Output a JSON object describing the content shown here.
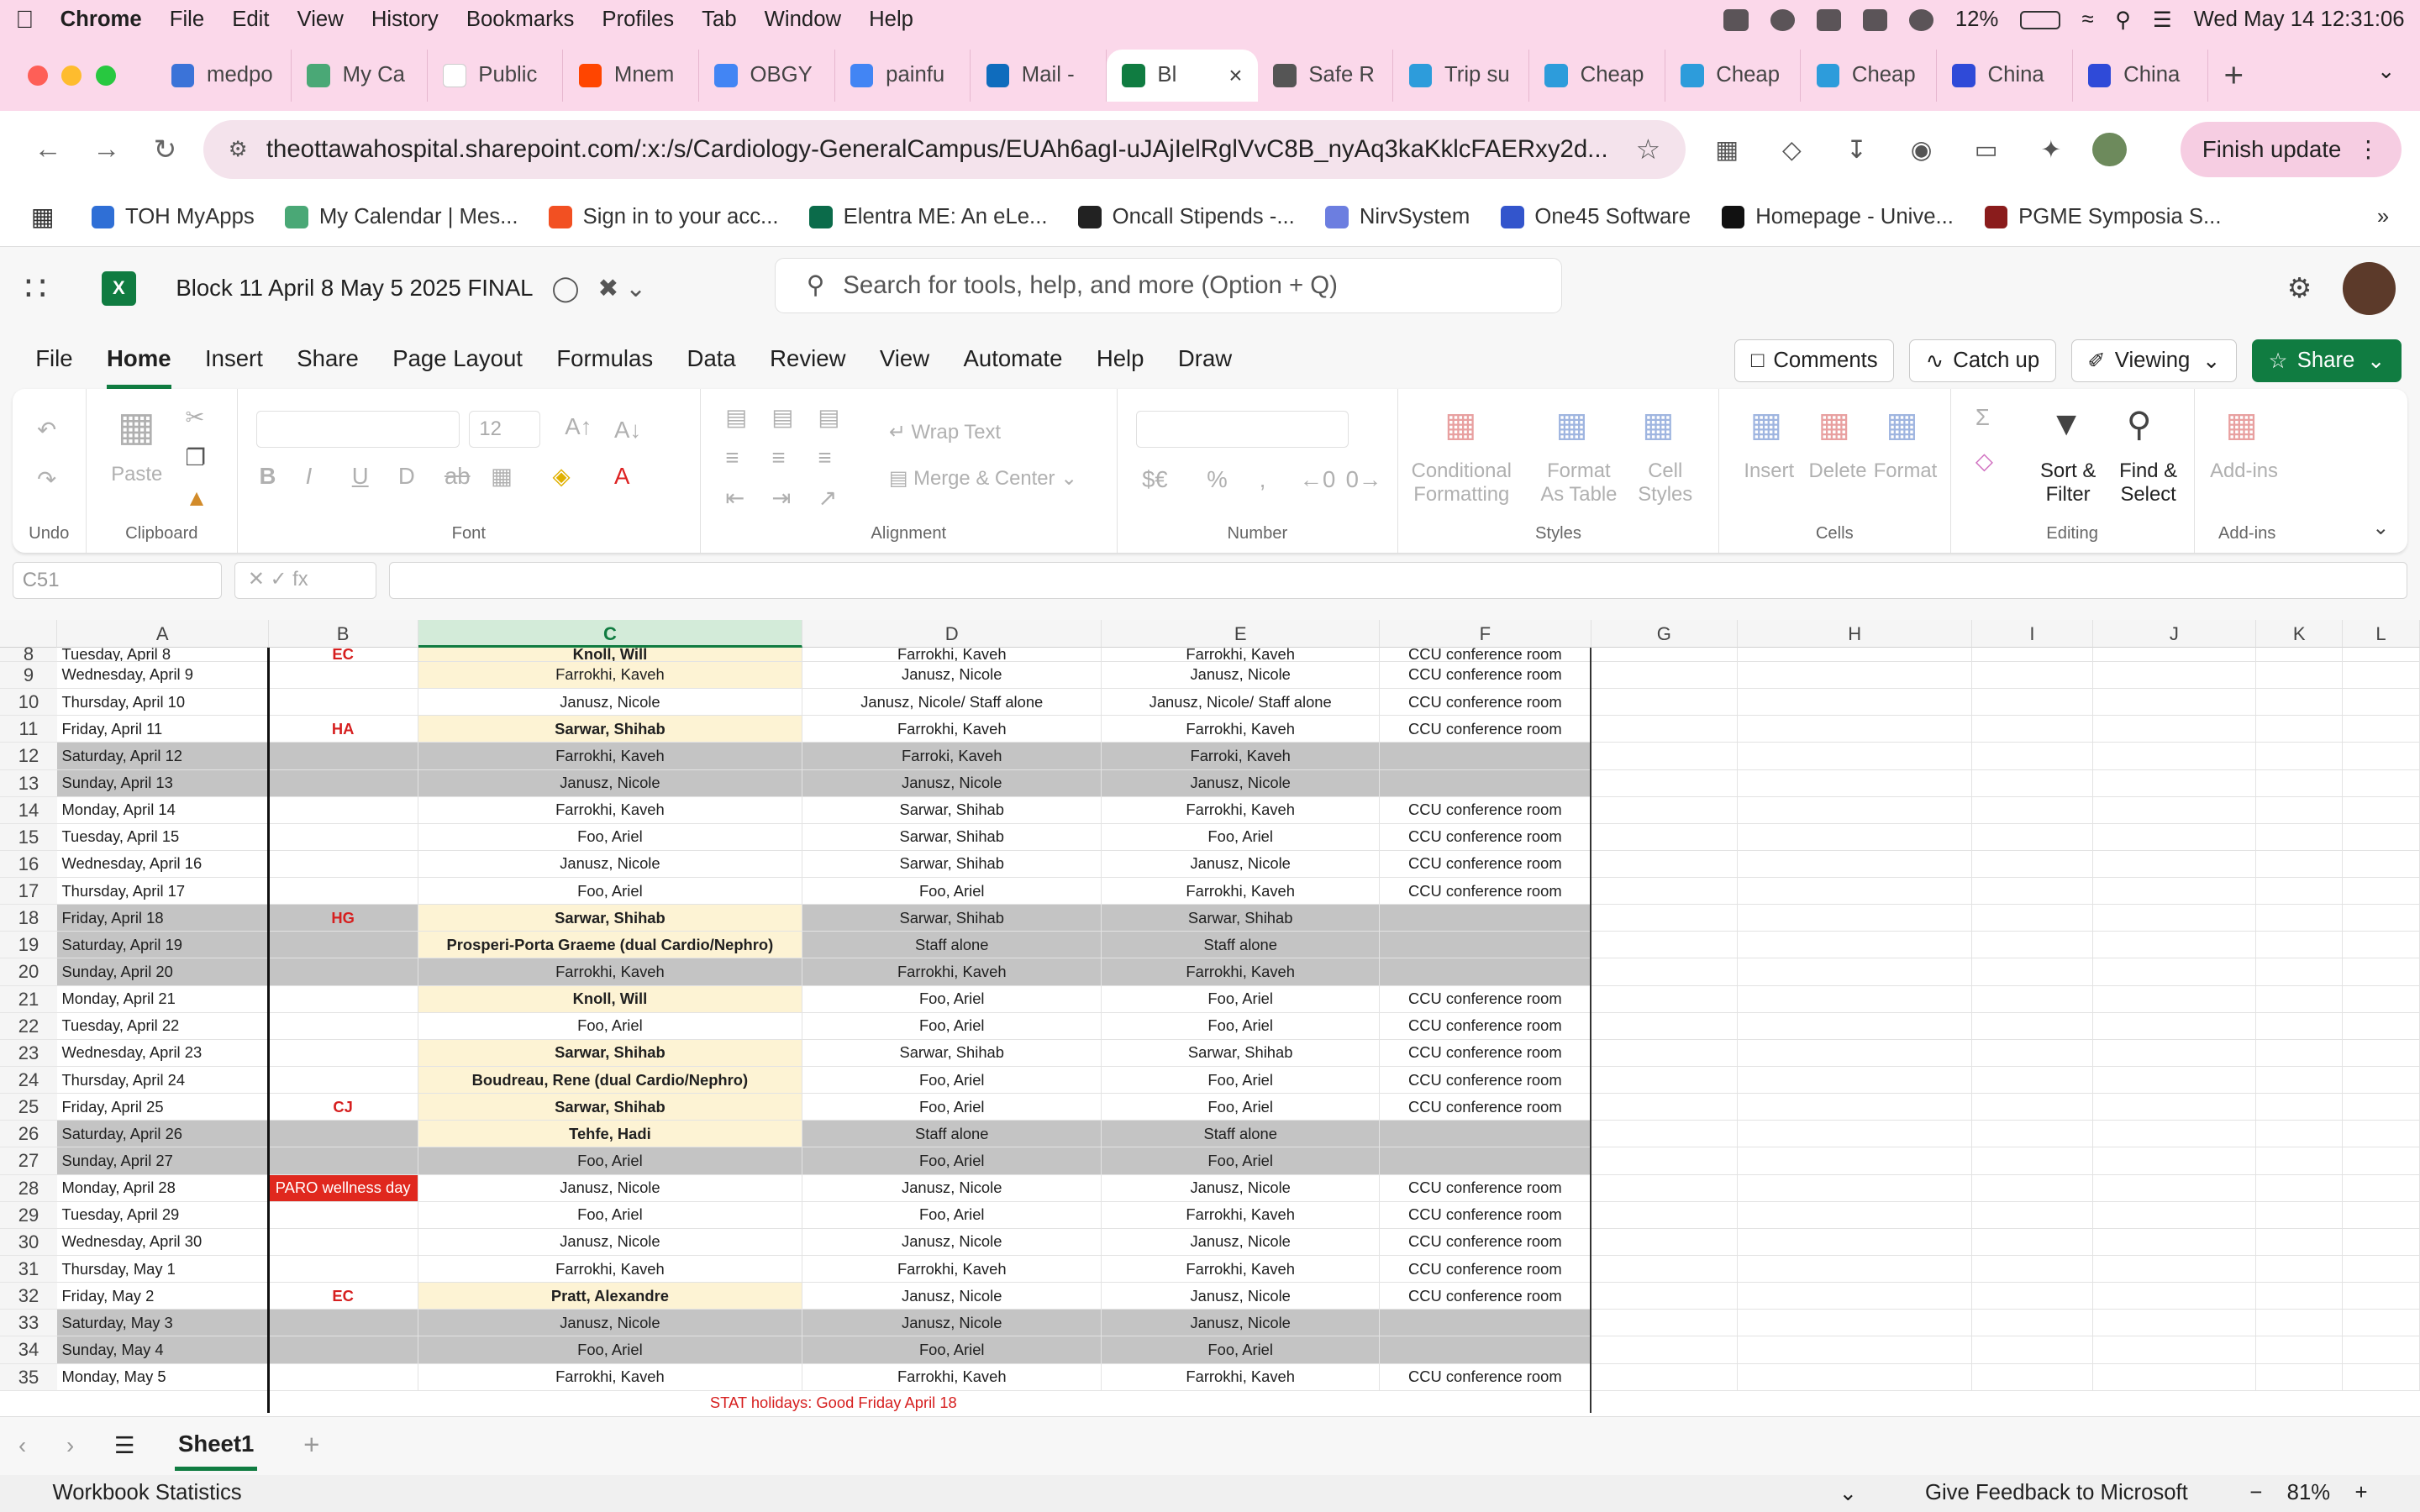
{
  "menubar": {
    "app": "Chrome",
    "items": [
      "File",
      "Edit",
      "View",
      "History",
      "Bookmarks",
      "Profiles",
      "Tab",
      "Window",
      "Help"
    ],
    "battery": "12%",
    "clock": "Wed May 14  12:31:06"
  },
  "tabs": [
    {
      "label": "medpo",
      "color": "#3b73d8"
    },
    {
      "label": "My Ca",
      "color": "#4aa876"
    },
    {
      "label": "Public",
      "color": "#ffffff"
    },
    {
      "label": "Mnem",
      "color": "#ff4500"
    },
    {
      "label": "OBGY",
      "color": "#4285f4"
    },
    {
      "label": "painfu",
      "color": "#4285f4"
    },
    {
      "label": "Mail -",
      "color": "#0f6cbd"
    },
    {
      "label": "Bl",
      "color": "#107c41"
    },
    {
      "label": "Safe R",
      "color": "#555555"
    },
    {
      "label": "Trip su",
      "color": "#2d9cdb"
    },
    {
      "label": "Cheap",
      "color": "#2d9cdb"
    },
    {
      "label": "Cheap",
      "color": "#2d9cdb"
    },
    {
      "label": "Cheap",
      "color": "#2d9cdb"
    },
    {
      "label": "China",
      "color": "#2f4ad8"
    },
    {
      "label": "China",
      "color": "#2f4ad8"
    }
  ],
  "address": {
    "url": "theottawahospital.sharepoint.com/:x:/s/Cardiology-GeneralCampus/EUAh6agI-uJAjIelRglVvC8B_nyAq3kaKklcFAERxy2d...",
    "finish": "Finish update"
  },
  "bookmarks": [
    {
      "label": "TOH MyApps",
      "color": "#2f6fd6"
    },
    {
      "label": "My Calendar | Mes...",
      "color": "#4aa876"
    },
    {
      "label": "Sign in to your acc...",
      "color": "#f25022"
    },
    {
      "label": "Elentra ME: An eLe...",
      "color": "#0b6b4a"
    },
    {
      "label": "Oncall Stipends -...",
      "color": "#222222"
    },
    {
      "label": "NirvSystem",
      "color": "#6c7ee0"
    },
    {
      "label": "One45 Software",
      "color": "#3355cc"
    },
    {
      "label": "Homepage - Unive...",
      "color": "#111111"
    },
    {
      "label": "PGME Symposia S...",
      "color": "#8a1c1c"
    }
  ],
  "excel": {
    "doc_title": "Block 11 April 8 May 5 2025 FINAL",
    "search_placeholder": "Search for tools, help, and more (Option + Q)"
  },
  "ribbon_tabs": [
    "File",
    "Home",
    "Insert",
    "Share",
    "Page Layout",
    "Formulas",
    "Data",
    "Review",
    "View",
    "Automate",
    "Help",
    "Draw"
  ],
  "ribbon_buttons": {
    "comments": "Comments",
    "catchup": "Catch up",
    "viewing": "Viewing",
    "share": "Share"
  },
  "ribbon": {
    "undo": "Undo",
    "clipboard": "Clipboard",
    "paste": "Paste",
    "font": "Font",
    "font_size": "12",
    "alignment": "Alignment",
    "wrap": "Wrap Text",
    "merge": "Merge & Center",
    "number": "Number",
    "styles": "Styles",
    "cond": "Conditional Formatting",
    "fmt_table": "Format As Table",
    "cell_styles": "Cell Styles",
    "cells": "Cells",
    "insert": "Insert",
    "delete": "Delete",
    "format": "Format",
    "editing": "Editing",
    "sort": "Sort & Filter",
    "find": "Find & Select",
    "addins": "Add-ins"
  },
  "namebox": "C51",
  "columns": [
    "A",
    "B",
    "C",
    "D",
    "E",
    "F",
    "G",
    "H",
    "I",
    "J",
    "K",
    "L"
  ],
  "rows": [
    {
      "n": "8",
      "a": "Tuesday, April 8",
      "b": "EC",
      "c": "Knoll, Will",
      "d": "Farrokhi, Kaveh",
      "e": "Farrokhi, Kaveh",
      "f": "CCU conference room",
      "w": false,
      "h": true
    },
    {
      "n": "9",
      "a": "Wednesday, April 9",
      "b": "",
      "c": "Farrokhi, Kaveh",
      "d": "Janusz, Nicole",
      "e": "Janusz, Nicole",
      "f": "CCU conference room",
      "w": false,
      "h": false,
      "hb": true
    },
    {
      "n": "10",
      "a": "Thursday, April 10",
      "b": "",
      "c": "Janusz, Nicole",
      "d": "Janusz, Nicole/ Staff alone",
      "e": "Janusz, Nicole/ Staff alone",
      "f": "CCU conference room",
      "w": false,
      "h": false
    },
    {
      "n": "11",
      "a": "Friday, April 11",
      "b": "HA",
      "c": "Sarwar, Shihab",
      "d": "Farrokhi, Kaveh",
      "e": "Farrokhi, Kaveh",
      "f": "CCU conference room",
      "w": false,
      "h": true
    },
    {
      "n": "12",
      "a": "Saturday, April 12",
      "b": "",
      "c": "Farrokhi, Kaveh",
      "d": "Farroki, Kaveh",
      "e": "Farroki, Kaveh",
      "f": "",
      "w": true,
      "h": false
    },
    {
      "n": "13",
      "a": "Sunday, April 13",
      "b": "",
      "c": "Janusz, Nicole",
      "d": "Janusz, Nicole",
      "e": "Janusz, Nicole",
      "f": "",
      "w": true,
      "h": false
    },
    {
      "n": "14",
      "a": "Monday, April 14",
      "b": "",
      "c": "Farrokhi, Kaveh",
      "d": "Sarwar, Shihab",
      "e": "Farrokhi, Kaveh",
      "f": "CCU conference room",
      "w": false,
      "h": false
    },
    {
      "n": "15",
      "a": "Tuesday, April 15",
      "b": "",
      "c": "Foo, Ariel",
      "d": "Sarwar, Shihab",
      "e": "Foo, Ariel",
      "f": "CCU conference room",
      "w": false,
      "h": false
    },
    {
      "n": "16",
      "a": "Wednesday, April 16",
      "b": "",
      "c": "Janusz, Nicole",
      "d": "Sarwar, Shihab",
      "e": "Janusz, Nicole",
      "f": "CCU conference room",
      "w": false,
      "h": false
    },
    {
      "n": "17",
      "a": "Thursday, April 17",
      "b": "",
      "c": "Foo, Ariel",
      "d": "Foo, Ariel",
      "e": "Farrokhi, Kaveh",
      "f": "CCU conference room",
      "w": false,
      "h": false
    },
    {
      "n": "18",
      "a": "Friday, April 18",
      "b": "HG",
      "c": "Sarwar, Shihab",
      "d": "Sarwar, Shihab",
      "e": "Sarwar, Shihab",
      "f": "",
      "w": true,
      "h": true
    },
    {
      "n": "19",
      "a": "Saturday, April 19",
      "b": "",
      "c": "Prosperi-Porta Graeme  (dual Cardio/Nephro)",
      "d": "Staff alone",
      "e": "Staff alone",
      "f": "",
      "w": true,
      "h": true
    },
    {
      "n": "20",
      "a": "Sunday, April 20",
      "b": "",
      "c": "Farrokhi, Kaveh",
      "d": "Farrokhi, Kaveh",
      "e": "Farrokhi, Kaveh",
      "f": "",
      "w": true,
      "h": false
    },
    {
      "n": "21",
      "a": "Monday, April 21",
      "b": "",
      "c": "Knoll, Will",
      "d": "Foo, Ariel",
      "e": "Foo, Ariel",
      "f": "CCU conference room",
      "w": false,
      "h": true
    },
    {
      "n": "22",
      "a": "Tuesday, April 22",
      "b": "",
      "c": "Foo, Ariel",
      "d": "Foo, Ariel",
      "e": "Foo, Ariel",
      "f": "CCU conference room",
      "w": false,
      "h": false
    },
    {
      "n": "23",
      "a": "Wednesday, April 23",
      "b": "",
      "c": "Sarwar, Shihab",
      "d": "Sarwar, Shihab",
      "e": "Sarwar, Shihab",
      "f": "CCU conference room",
      "w": false,
      "h": true
    },
    {
      "n": "24",
      "a": "Thursday, April 24",
      "b": "",
      "c": "Boudreau, Rene (dual Cardio/Nephro)",
      "d": "Foo, Ariel",
      "e": "Foo, Ariel",
      "f": "CCU conference room",
      "w": false,
      "h": true
    },
    {
      "n": "25",
      "a": "Friday, April 25",
      "b": "CJ",
      "c": "Sarwar, Shihab",
      "d": "Foo, Ariel",
      "e": "Foo, Ariel",
      "f": "CCU conference room",
      "w": false,
      "h": true
    },
    {
      "n": "26",
      "a": "Saturday, April 26",
      "b": "",
      "c": "Tehfe, Hadi",
      "d": "Staff alone",
      "e": "Staff alone",
      "f": "",
      "w": true,
      "h": true
    },
    {
      "n": "27",
      "a": "Sunday, April 27",
      "b": "",
      "c": "Foo, Ariel",
      "d": "Foo, Ariel",
      "e": "Foo, Ariel",
      "f": "",
      "w": true,
      "h": false
    },
    {
      "n": "28",
      "a": "Monday, April 28",
      "b": "PARO wellness day",
      "c": "Janusz, Nicole",
      "d": "Janusz, Nicole",
      "e": "Janusz, Nicole",
      "f": "CCU conference room",
      "w": false,
      "h": false,
      "paro": true
    },
    {
      "n": "29",
      "a": "Tuesday, April 29",
      "b": "",
      "c": "Foo, Ariel",
      "d": "Foo, Ariel",
      "e": "Farrokhi, Kaveh",
      "f": "CCU conference room",
      "w": false,
      "h": false
    },
    {
      "n": "30",
      "a": "Wednesday, April 30",
      "b": "",
      "c": "Janusz, Nicole",
      "d": "Janusz, Nicole",
      "e": "Janusz, Nicole",
      "f": "CCU conference room",
      "w": false,
      "h": false
    },
    {
      "n": "31",
      "a": "Thursday, May 1",
      "b": "",
      "c": "Farrokhi, Kaveh",
      "d": "Farrokhi, Kaveh",
      "e": "Farrokhi, Kaveh",
      "f": "CCU conference room",
      "w": false,
      "h": false
    },
    {
      "n": "32",
      "a": "Friday, May 2",
      "b": "EC",
      "c": "Pratt, Alexandre",
      "d": "Janusz, Nicole",
      "e": "Janusz, Nicole",
      "f": "CCU conference room",
      "w": false,
      "h": true
    },
    {
      "n": "33",
      "a": "Saturday, May 3",
      "b": "",
      "c": "Janusz, Nicole",
      "d": "Janusz, Nicole",
      "e": "Janusz, Nicole",
      "f": "",
      "w": true,
      "h": false
    },
    {
      "n": "34",
      "a": "Sunday, May 4",
      "b": "",
      "c": "Foo, Ariel",
      "d": "Foo, Ariel",
      "e": "Foo, Ariel",
      "f": "",
      "w": true,
      "h": false
    },
    {
      "n": "35",
      "a": "Monday, May 5",
      "b": "",
      "c": "Farrokhi, Kaveh",
      "d": "Farrokhi, Kaveh",
      "e": "Farrokhi, Kaveh",
      "f": "CCU conference room",
      "w": false,
      "h": false
    }
  ],
  "stat_note": "STAT holidays: Good Friday April 18",
  "sheet_tab": "Sheet1",
  "status": {
    "left": "Workbook Statistics",
    "feedback": "Give Feedback to Microsoft",
    "zoom": "81%"
  }
}
